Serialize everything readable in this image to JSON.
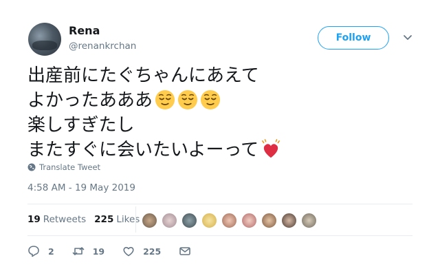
{
  "user": {
    "name": "Rena",
    "handle": "@renankrchan",
    "avatar_icon": "profile-photo"
  },
  "follow": {
    "label": "Follow",
    "accent": "#1da1f2"
  },
  "tweet": {
    "lines": [
      "出産前にたぐちゃんにあえて",
      "よかったあああ",
      "楽しすぎたし",
      "またすぐに会いたいよーって"
    ],
    "line2_emoji": "relieved-face-emoji",
    "line4_emoji": "beating-heart-emoji",
    "translate_label": "Translate Tweet",
    "timestamp": "4:58 AM - 19 May 2019"
  },
  "stats": {
    "retweets_count": "19",
    "retweets_label": "Retweets",
    "likes_count": "225",
    "likes_label": "Likes"
  },
  "actions": {
    "reply_count": "2",
    "retweet_count": "19",
    "like_count": "225"
  },
  "colors": {
    "text": "#14171a",
    "muted": "#657786",
    "border": "#e6ecf0"
  }
}
